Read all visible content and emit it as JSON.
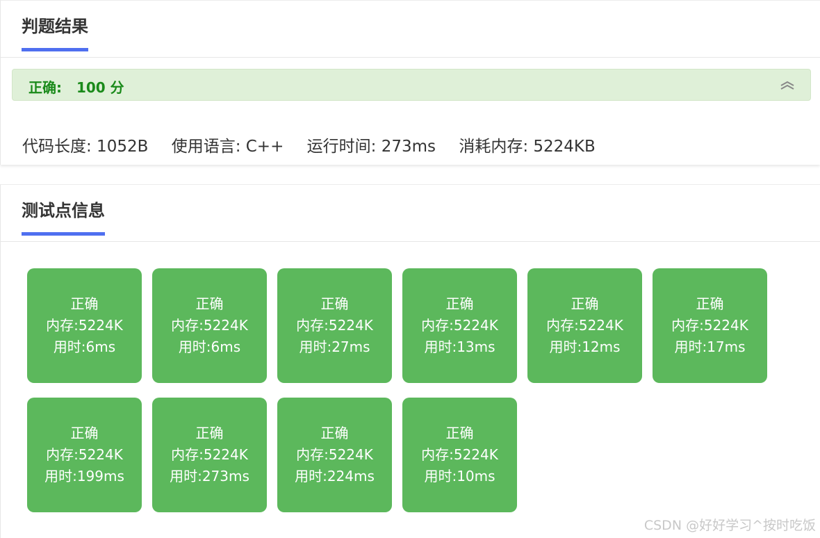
{
  "judge": {
    "title": "判题结果",
    "status_label": "正确:",
    "score": "100 分",
    "meta": [
      "代码长度: 1052B",
      "使用语言: C++",
      "运行时间: 273ms",
      "消耗内存: 5224KB"
    ]
  },
  "tests": {
    "title": "测试点信息",
    "cases": [
      {
        "status": "正确",
        "memory": "内存:5224K",
        "time": "用时:6ms"
      },
      {
        "status": "正确",
        "memory": "内存:5224K",
        "time": "用时:6ms"
      },
      {
        "status": "正确",
        "memory": "内存:5224K",
        "time": "用时:27ms"
      },
      {
        "status": "正确",
        "memory": "内存:5224K",
        "time": "用时:13ms"
      },
      {
        "status": "正确",
        "memory": "内存:5224K",
        "time": "用时:12ms"
      },
      {
        "status": "正确",
        "memory": "内存:5224K",
        "time": "用时:17ms"
      },
      {
        "status": "正确",
        "memory": "内存:5224K",
        "time": "用时:199ms"
      },
      {
        "status": "正确",
        "memory": "内存:5224K",
        "time": "用时:273ms"
      },
      {
        "status": "正确",
        "memory": "内存:5224K",
        "time": "用时:224ms"
      },
      {
        "status": "正确",
        "memory": "内存:5224K",
        "time": "用时:10ms"
      }
    ]
  },
  "watermark": "CSDN @好好学习^按时吃饭",
  "colors": {
    "accent": "#4f6ff0",
    "success_bg": "#dff0d8",
    "success_text": "#1a8a1a",
    "case_bg": "#5cb85c"
  },
  "icons": {
    "collapse": "chevron-double-up-icon"
  }
}
